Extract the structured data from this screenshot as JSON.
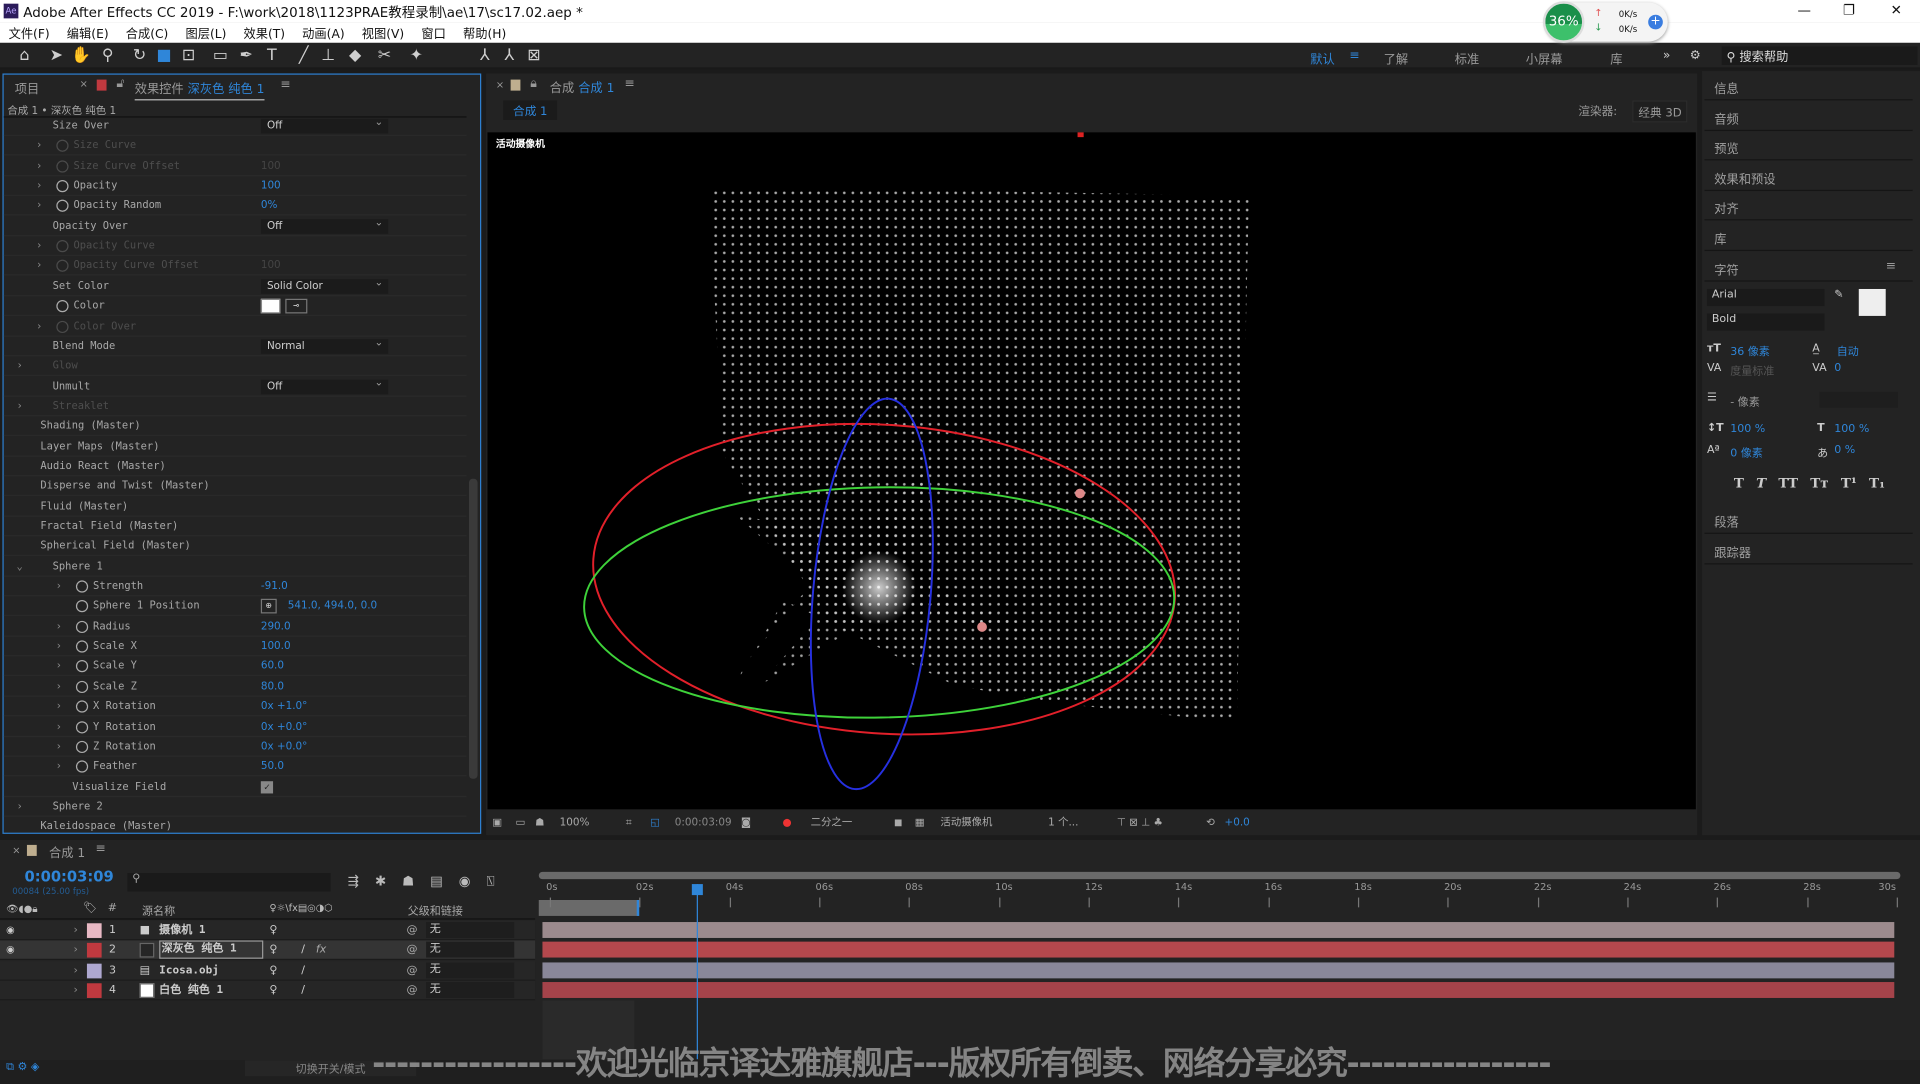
{
  "window": {
    "app_icon": "Ae",
    "title": "Adobe After Effects CC 2019 - F:\\work\\2018\\1123PRAE教程录制\\ae\\17\\sc17.02.aep *",
    "minimize": "—",
    "maximize": "❐",
    "close": "✕"
  },
  "menu": [
    "文件(F)",
    "编辑(E)",
    "合成(C)",
    "图层(L)",
    "效果(T)",
    "动画(A)",
    "视图(V)",
    "窗口",
    "帮助(H)"
  ],
  "netwidget": {
    "percent": "36%",
    "up": "0K/s",
    "down": "0K/s"
  },
  "workspaces": {
    "items": [
      "默认",
      "了解",
      "标准",
      "小屏幕",
      "库"
    ],
    "active": "默认",
    "more": "»",
    "search_placeholder": "搜索帮助"
  },
  "effects_panel": {
    "tab_project": "项目",
    "tab_effects": "效果控件",
    "layer_name": "深灰色 纯色 1",
    "breadcrumb": "合成 1 • 深灰色 纯色 1",
    "rows": [
      {
        "label": "Size Over",
        "level": 1,
        "type": "select",
        "value": "Off"
      },
      {
        "label": "Size Curve",
        "level": 2,
        "dim": true,
        "chev": true,
        "sw": true
      },
      {
        "label": "Size Curve Offset",
        "level": 2,
        "dim": true,
        "chev": true,
        "sw": true,
        "value": "100"
      },
      {
        "label": "Opacity",
        "level": 2,
        "chev": true,
        "sw": true,
        "value": "100"
      },
      {
        "label": "Opacity Random",
        "level": 2,
        "chev": true,
        "sw": true,
        "value": "0%"
      },
      {
        "label": "Opacity Over",
        "level": 1,
        "type": "select",
        "value": "Off"
      },
      {
        "label": "Opacity Curve",
        "level": 2,
        "dim": true,
        "chev": true,
        "sw": true
      },
      {
        "label": "Opacity Curve Offset",
        "level": 2,
        "dim": true,
        "chev": true,
        "sw": true,
        "value": "100"
      },
      {
        "label": "Set Color",
        "level": 1,
        "type": "select",
        "value": "Solid Color"
      },
      {
        "label": "Color",
        "level": 2,
        "sw": true,
        "type": "color"
      },
      {
        "label": "Color Over",
        "level": 2,
        "dim": true,
        "chev": true,
        "sw": true
      },
      {
        "label": "Blend Mode",
        "level": 1,
        "type": "select",
        "value": "Normal"
      },
      {
        "label": "Glow",
        "level": 1,
        "dim": true,
        "chev": true
      },
      {
        "label": "Unmult",
        "level": 1,
        "type": "select",
        "value": "Off"
      },
      {
        "label": "Streaklet",
        "level": 1,
        "dim": true,
        "chev": true
      },
      {
        "label": "Shading (Master)",
        "level": 0,
        "chev": true
      },
      {
        "label": "Layer Maps (Master)",
        "level": 0,
        "chev": true
      },
      {
        "label": "Audio React (Master)",
        "level": 0,
        "chev": true
      },
      {
        "label": "Disperse and Twist (Master)",
        "level": 0,
        "chev": true
      },
      {
        "label": "Fluid (Master)",
        "level": 0,
        "chev": true
      },
      {
        "label": "Fractal Field (Master)",
        "level": 0,
        "chev": true
      },
      {
        "label": "Spherical Field (Master)",
        "level": 0,
        "chev": true,
        "open": true
      },
      {
        "label": "Sphere 1",
        "level": 1,
        "chev": true,
        "open": true
      },
      {
        "label": "Strength",
        "level": 3,
        "chev": true,
        "sw": true,
        "value": "-91.0"
      },
      {
        "label": "Sphere 1 Position",
        "level": 3,
        "sw": true,
        "type": "point",
        "value": "541.0, 494.0, 0.0"
      },
      {
        "label": "Radius",
        "level": 3,
        "chev": true,
        "sw": true,
        "value": "290.0"
      },
      {
        "label": "Scale X",
        "level": 3,
        "chev": true,
        "sw": true,
        "value": "100.0"
      },
      {
        "label": "Scale Y",
        "level": 3,
        "chev": true,
        "sw": true,
        "value": "60.0"
      },
      {
        "label": "Scale Z",
        "level": 3,
        "chev": true,
        "sw": true,
        "value": "80.0"
      },
      {
        "label": "X Rotation",
        "level": 3,
        "chev": true,
        "sw": true,
        "value": "0x +1.0°"
      },
      {
        "label": "Y Rotation",
        "level": 3,
        "chev": true,
        "sw": true,
        "value": "0x +0.0°"
      },
      {
        "label": "Z Rotation",
        "level": 3,
        "chev": true,
        "sw": true,
        "value": "0x +0.0°"
      },
      {
        "label": "Feather",
        "level": 3,
        "chev": true,
        "sw": true,
        "value": "50.0"
      },
      {
        "label": "Visualize Field",
        "level": 2,
        "type": "checkbox",
        "checked": true
      },
      {
        "label": "Sphere 2",
        "level": 1,
        "chev": true
      },
      {
        "label": "Kaleidospace (Master)",
        "level": 0,
        "chev": true
      }
    ]
  },
  "viewer": {
    "tab_prefix": "合成",
    "comp_name": "合成 1",
    "breadcrumb": "合成 1",
    "renderer_label": "渲染器:",
    "renderer": "经典 3D",
    "camera_label": "活动摄像机",
    "footer": {
      "zoom": "100%",
      "timecode": "0:00:03:09",
      "resolution": "二分之一",
      "camera": "活动摄像机",
      "views": "1 个...",
      "exposure": "+0.0"
    }
  },
  "right_panel": {
    "items": [
      "信息",
      "音频",
      "预览",
      "效果和预设",
      "对齐",
      "库",
      "字符"
    ],
    "bottom_items": [
      "段落",
      "跟踪器"
    ],
    "character": {
      "font": "Arial",
      "style": "Bold",
      "size": "36 像素",
      "leading": "自动",
      "kerning": "度量标准",
      "tracking": "0",
      "stroke": "- 像素",
      "vscale": "100 %",
      "hscale": "100 %",
      "baseline": "0 像素",
      "tsume": "0 %",
      "styles": [
        "T",
        "T",
        "TT",
        "Tт",
        "T¹",
        "T₁"
      ]
    }
  },
  "timeline": {
    "tab": "合成 1",
    "timecode": "0:00:03:09",
    "frame_info": "00084 (25.00 fps)",
    "search_placeholder": "",
    "headers": {
      "num": "#",
      "source": "源名称",
      "parent": "父级和链接"
    },
    "ruler": [
      "0s",
      "02s",
      "04s",
      "06s",
      "08s",
      "10s",
      "12s",
      "14s",
      "16s",
      "18s",
      "20s",
      "22s",
      "24s",
      "26s",
      "28s",
      "30s"
    ],
    "current_time_seconds": 3.36,
    "duration_seconds": 30,
    "layers": [
      {
        "num": "1",
        "name": "摄像机 1",
        "type": "camera",
        "label_color": "#e8b9c4",
        "bar_color": "#9c8a8d",
        "visible": true,
        "parent": "无"
      },
      {
        "num": "2",
        "name": "深灰色 纯色 1",
        "type": "solid",
        "label_color": "#c0393f",
        "bar_color": "#b4484d",
        "visible": true,
        "selected": true,
        "fx": true,
        "parent": "无"
      },
      {
        "num": "3",
        "name": "Icosa.obj",
        "type": "file",
        "label_color": "#aea8d0",
        "bar_color": "#898799",
        "visible": false,
        "parent": "无"
      },
      {
        "num": "4",
        "name": "白色 纯色 1",
        "type": "solid",
        "label_color": "#c0393f",
        "bar_color": "#a5434a",
        "visible": false,
        "parent": "无"
      }
    ]
  },
  "statusbar": {
    "toggle_label": "切换开关/模式"
  },
  "watermark": "-----------------欢迎光临京译达雅旗舰店---版权所有倒卖、网络分享必究-----------------",
  "colors": {
    "accent": "#2f86d9",
    "panel": "#232323",
    "active_border": "#2d7fd0"
  }
}
